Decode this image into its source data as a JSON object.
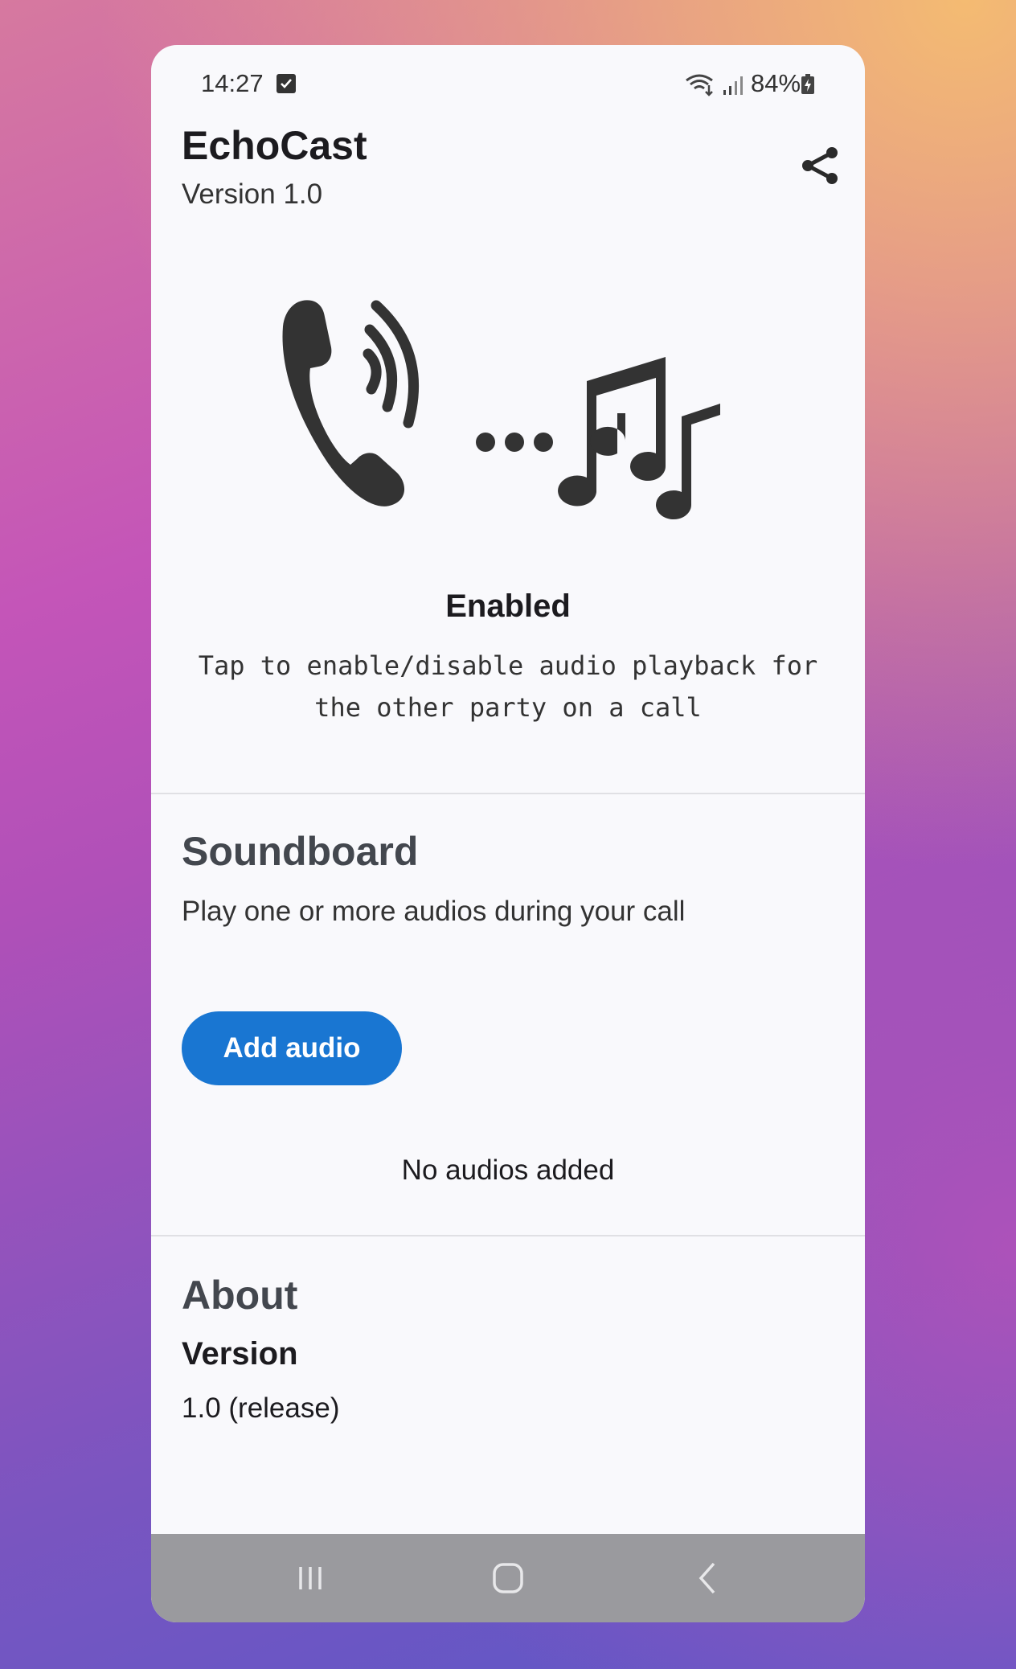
{
  "status_bar": {
    "time": "14:27",
    "battery": "84%",
    "icons": [
      "checkbox-notification-icon",
      "wifi-icon",
      "signal-icon",
      "battery-charging-icon"
    ]
  },
  "header": {
    "title": "EchoCast",
    "version": "Version 1.0",
    "share_icon": "share-icon"
  },
  "hero": {
    "icons": [
      "phone-icon",
      "sound-waves-icon",
      "dots-icon",
      "music-notes-icon"
    ]
  },
  "toggle": {
    "status": "Enabled",
    "description": "Tap to enable/disable audio playback for the other party on a call"
  },
  "soundboard": {
    "title": "Soundboard",
    "description": "Play one or more audios during your call",
    "add_button": "Add audio",
    "empty_text": "No audios added"
  },
  "about": {
    "title": "About",
    "version_label": "Version",
    "version_value": "1.0 (release)"
  },
  "nav_bar": {
    "buttons": [
      "recent-apps-icon",
      "home-icon",
      "back-icon"
    ]
  },
  "colors": {
    "accent": "#1976d2",
    "background": "#f9f9fc",
    "nav_bar": "#9a9a9e"
  }
}
